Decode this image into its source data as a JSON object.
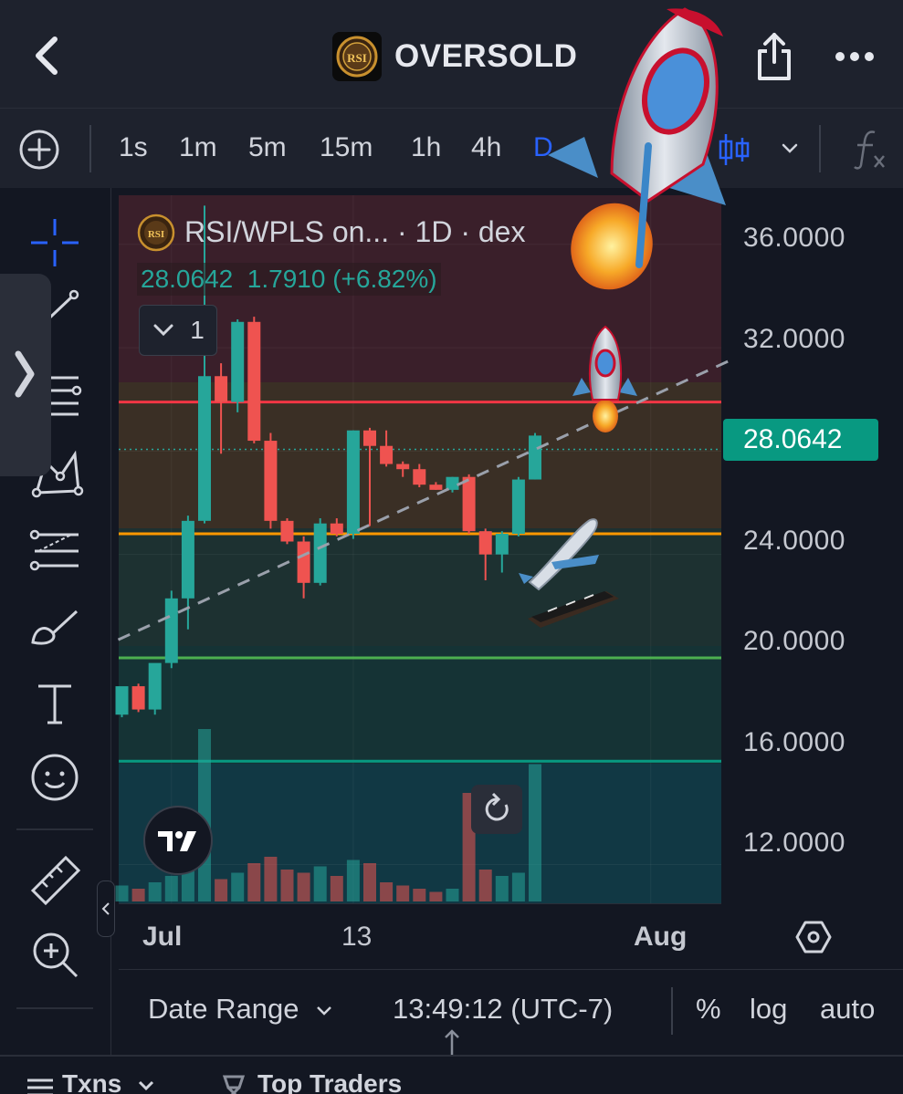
{
  "header": {
    "title": "OVERSOLD",
    "token_logo_text": "RSI"
  },
  "toolbar": {
    "intervals": [
      "1s",
      "1m",
      "5m",
      "15m",
      "1h",
      "4h",
      "D"
    ],
    "active_interval": "D"
  },
  "legend": {
    "title": "RSI/WPLS on... · 1D · dex",
    "last": "28.0642",
    "change": "1.7910 (+6.82%)",
    "collapse_count": "1"
  },
  "price_axis": {
    "labels": [
      "36.0000",
      "32.0000",
      "28.0000",
      "24.0000",
      "20.0000",
      "16.0000",
      "12.0000"
    ],
    "last_price": "28.0642"
  },
  "time_axis": {
    "labels": [
      "Jul",
      "13",
      "Aug"
    ]
  },
  "bottom_bar": {
    "date_range": "Date Range",
    "clock": "13:49:12 (UTC-7)",
    "percent": "%",
    "log": "log",
    "auto": "auto"
  },
  "bottom_tabs": [
    "Txns",
    "Top Traders"
  ],
  "colors": {
    "up": "#26a69a",
    "down": "#ef5350",
    "accent": "#2962ff",
    "hline_red": "#f23645",
    "hline_orange": "#ff9800",
    "hline_green": "#4caf50",
    "hline_teal": "#089981"
  },
  "chart_data": {
    "type": "candlestick",
    "symbol": "RSI/WPLS",
    "interval": "1D",
    "ylim": [
      10.5,
      37.9
    ],
    "horizontal_lines": [
      {
        "price": 29.9,
        "color": "#f23645"
      },
      {
        "price": 24.8,
        "color": "#ff9800"
      },
      {
        "price": 20.0,
        "color": "#4caf50"
      },
      {
        "price": 16.0,
        "color": "#089981"
      }
    ],
    "trendline": {
      "from": [
        0,
        20.7
      ],
      "to": [
        37,
        31.6
      ]
    },
    "candles": [
      {
        "o": 17.8,
        "h": 18.8,
        "l": 17.7,
        "c": 18.9,
        "v": 0.5
      },
      {
        "o": 18.9,
        "h": 19.0,
        "l": 17.9,
        "c": 18.0,
        "v": 0.4
      },
      {
        "o": 18.0,
        "h": 19.0,
        "l": 17.8,
        "c": 19.8,
        "v": 0.6
      },
      {
        "o": 19.8,
        "h": 22.6,
        "l": 19.6,
        "c": 22.3,
        "v": 0.8
      },
      {
        "o": 22.3,
        "h": 25.5,
        "l": 21.1,
        "c": 25.3,
        "v": 1.0
      },
      {
        "o": 25.3,
        "h": 37.5,
        "l": 25.2,
        "c": 30.9,
        "v": 5.4
      },
      {
        "o": 30.9,
        "h": 31.4,
        "l": 27.9,
        "c": 29.9,
        "v": 0.7
      },
      {
        "o": 29.9,
        "h": 33.1,
        "l": 29.5,
        "c": 33.0,
        "v": 0.9
      },
      {
        "o": 33.0,
        "h": 33.2,
        "l": 28.3,
        "c": 28.4,
        "v": 1.2
      },
      {
        "o": 28.4,
        "h": 28.7,
        "l": 25.0,
        "c": 25.3,
        "v": 1.4
      },
      {
        "o": 25.3,
        "h": 25.4,
        "l": 24.4,
        "c": 24.5,
        "v": 1.0
      },
      {
        "o": 24.5,
        "h": 24.7,
        "l": 22.3,
        "c": 22.9,
        "v": 0.9
      },
      {
        "o": 22.9,
        "h": 25.4,
        "l": 22.8,
        "c": 25.2,
        "v": 1.1
      },
      {
        "o": 25.2,
        "h": 25.4,
        "l": 24.7,
        "c": 24.8,
        "v": 0.8
      },
      {
        "o": 24.8,
        "h": 28.8,
        "l": 24.6,
        "c": 28.8,
        "v": 1.3
      },
      {
        "o": 28.8,
        "h": 28.9,
        "l": 25.1,
        "c": 28.2,
        "v": 1.2
      },
      {
        "o": 28.2,
        "h": 28.8,
        "l": 27.4,
        "c": 27.5,
        "v": 0.6
      },
      {
        "o": 27.5,
        "h": 27.6,
        "l": 27.0,
        "c": 27.3,
        "v": 0.5
      },
      {
        "o": 27.3,
        "h": 27.5,
        "l": 26.6,
        "c": 26.7,
        "v": 0.4
      },
      {
        "o": 26.7,
        "h": 26.8,
        "l": 26.5,
        "c": 26.5,
        "v": 0.3
      },
      {
        "o": 26.5,
        "h": 27.0,
        "l": 26.4,
        "c": 27.0,
        "v": 0.4
      },
      {
        "o": 27.0,
        "h": 27.1,
        "l": 24.8,
        "c": 24.9,
        "v": 3.4
      },
      {
        "o": 24.9,
        "h": 25.0,
        "l": 23.0,
        "c": 24.0,
        "v": 1.0
      },
      {
        "o": 24.0,
        "h": 24.9,
        "l": 23.3,
        "c": 24.8,
        "v": 0.8
      },
      {
        "o": 24.8,
        "h": 27.0,
        "l": 24.7,
        "c": 26.9,
        "v": 0.9
      },
      {
        "o": 26.9,
        "h": 28.7,
        "l": 26.9,
        "c": 28.6,
        "v": 4.3
      }
    ]
  }
}
